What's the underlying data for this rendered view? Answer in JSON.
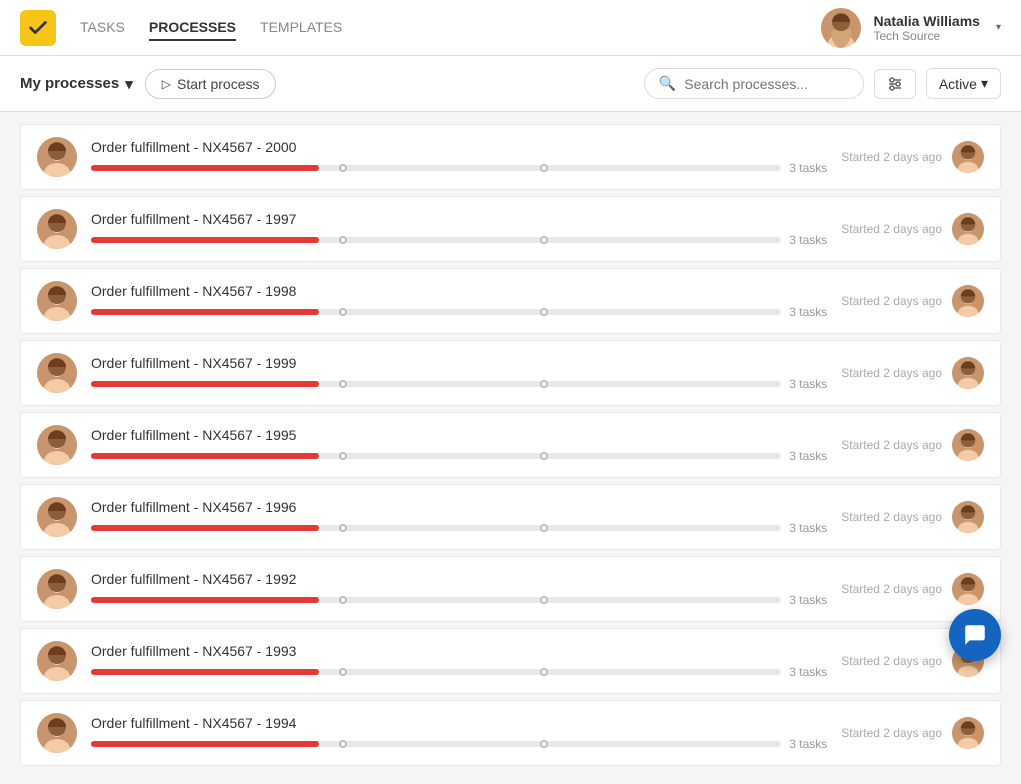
{
  "nav": {
    "logo_alt": "Logo",
    "links": [
      {
        "label": "TASKS",
        "active": false
      },
      {
        "label": "PROCESSES",
        "active": true
      },
      {
        "label": "TEMPLATES",
        "active": false
      }
    ]
  },
  "user": {
    "name": "Natalia Williams",
    "company": "Tech Source",
    "chevron": "▾"
  },
  "toolbar": {
    "my_processes_label": "My processes",
    "my_processes_chevron": "▾",
    "start_process_label": "Start process",
    "search_placeholder": "Search processes...",
    "active_label": "Active",
    "active_chevron": "▾"
  },
  "processes": [
    {
      "title": "Order fulfillment - NX4567 - 2000",
      "tasks": "3 tasks",
      "started": "Started 2 days ago",
      "progress": 33
    },
    {
      "title": "Order fulfillment - NX4567 - 1997",
      "tasks": "3 tasks",
      "started": "Started 2 days ago",
      "progress": 33
    },
    {
      "title": "Order fulfillment - NX4567 - 1998",
      "tasks": "3 tasks",
      "started": "Started 2 days ago",
      "progress": 33
    },
    {
      "title": "Order fulfillment - NX4567 - 1999",
      "tasks": "3 tasks",
      "started": "Started 2 days ago",
      "progress": 33
    },
    {
      "title": "Order fulfillment - NX4567 - 1995",
      "tasks": "3 tasks",
      "started": "Started 2 days ago",
      "progress": 33
    },
    {
      "title": "Order fulfillment - NX4567 - 1996",
      "tasks": "3 tasks",
      "started": "Started 2 days ago",
      "progress": 33
    },
    {
      "title": "Order fulfillment - NX4567 - 1992",
      "tasks": "3 tasks",
      "started": "Started 2 days ago",
      "progress": 33
    },
    {
      "title": "Order fulfillment - NX4567 - 1993",
      "tasks": "3 tasks",
      "started": "Started 2 days ago",
      "progress": 33
    },
    {
      "title": "Order fulfillment - NX4567 - 1994",
      "tasks": "3 tasks",
      "started": "Started 2 days ago",
      "progress": 33
    }
  ],
  "chat": {
    "icon_alt": "chat"
  }
}
